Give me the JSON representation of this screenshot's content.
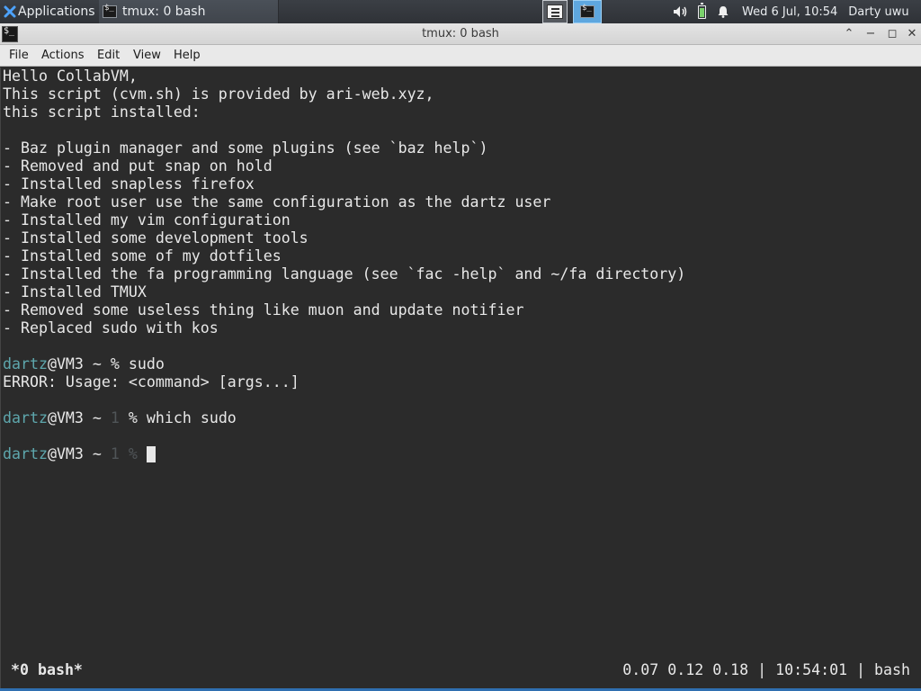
{
  "panel": {
    "applications_label": "Applications",
    "task_label": "tmux: 0 bash",
    "clock": "Wed  6 Jul, 10:54",
    "user": "Darty uwu",
    "icons": [
      "xfce-logo-icon",
      "terminal-icon",
      "text-editor-icon",
      "volume-icon",
      "battery-icon",
      "notification-bell-icon"
    ]
  },
  "window": {
    "title": "tmux: 0 bash",
    "menu": [
      "File",
      "Actions",
      "Edit",
      "View",
      "Help"
    ]
  },
  "terminal": {
    "lines": [
      "Hello CollabVM,",
      "This script (cvm.sh) is provided by ari-web.xyz,",
      "this script installed:",
      "",
      "- Baz plugin manager and some plugins (see `baz help`)",
      "- Removed and put snap on hold",
      "- Installed snapless firefox",
      "- Make root user use the same configuration as the dartz user",
      "- Installed my vim configuration",
      "- Installed some development tools",
      "- Installed some of my dotfiles",
      "- Installed the fa programming language (see `fac -help` and ~/fa directory)",
      "- Installed TMUX",
      "- Removed some useless thing like muon and update notifier",
      "- Replaced sudo with kos"
    ],
    "prompt_user": "dartz",
    "prompt_host": "@VM3 ~ ",
    "prompt_exit": "1",
    "prompt_symbol": "%",
    "commands": [
      "sudo",
      "which sudo"
    ],
    "error_output": "ERROR: Usage: <command> [args...]"
  },
  "tmux": {
    "window_label": "*0 bash*",
    "status_right": "0.07 0.12 0.18 | 10:54:01 | bash"
  },
  "colors": {
    "terminal_bg": "#2b2b2b",
    "terminal_fg": "#e8e8e8",
    "prompt_user": "#5ea7ad",
    "prompt_exit": "#505558",
    "panel_bg": "#35383d",
    "active_launcher": "#5ea7df"
  }
}
